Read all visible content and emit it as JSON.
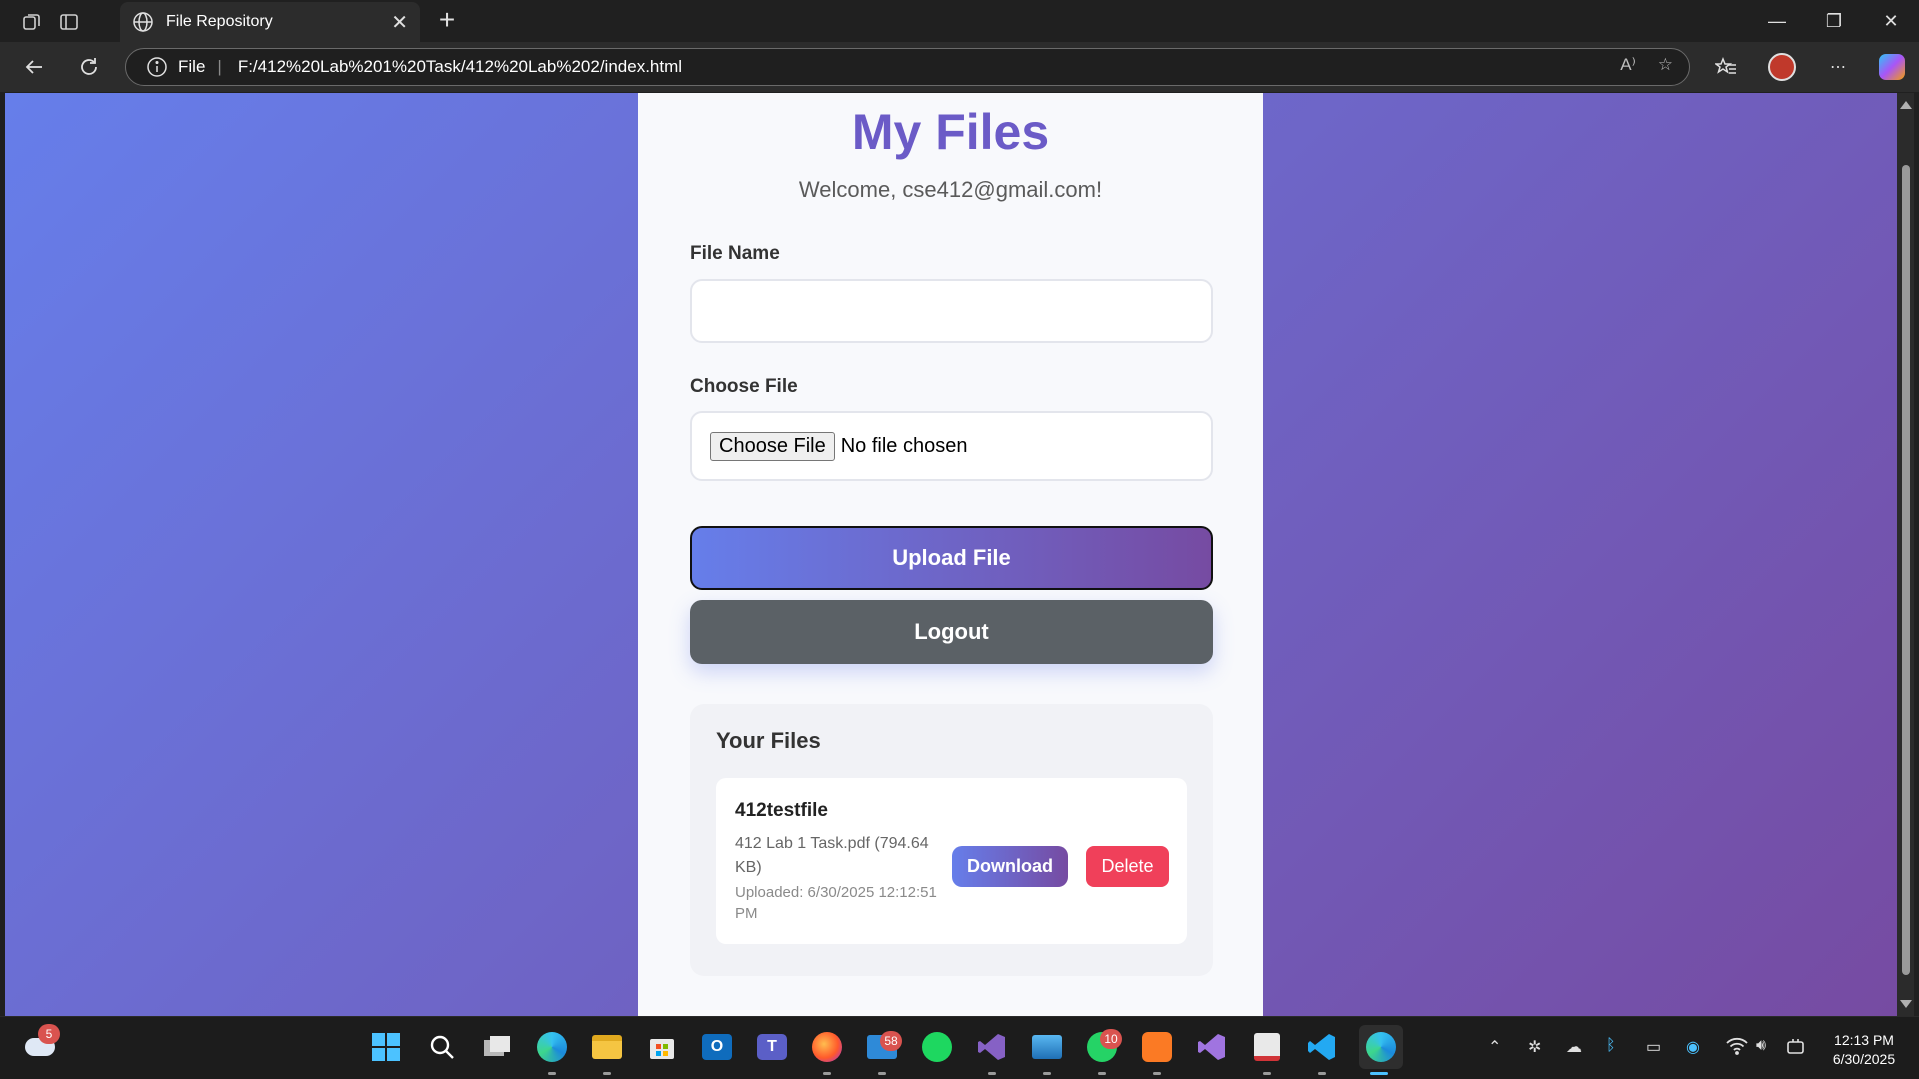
{
  "browser": {
    "tab_title": "File Repository",
    "url_protocol": "File",
    "url_separator": "|",
    "url": "F:/412%20Lab%201%20Task/412%20Lab%202/index.html"
  },
  "page": {
    "title": "My Files",
    "welcome": "Welcome, cse412@gmail.com!",
    "file_name_label": "File Name",
    "file_name_value": "",
    "choose_file_label": "Choose File",
    "choose_file_button": "Choose File",
    "no_file_text": "No file chosen",
    "upload_button": "Upload File",
    "logout_button": "Logout",
    "files_heading": "Your Files",
    "files": [
      {
        "name": "412testfile",
        "meta": "412 Lab 1 Task.pdf (794.64 KB)",
        "uploaded": "Uploaded: 6/30/2025 12:12:51 PM",
        "download_label": "Download",
        "delete_label": "Delete"
      }
    ]
  },
  "taskbar": {
    "weather_badge": "5",
    "mail_badge": "58",
    "whatsapp_badge": "10",
    "time": "12:13 PM",
    "date": "6/30/2025"
  },
  "colors": {
    "gradient_start": "#667eea",
    "gradient_end": "#764ba2",
    "title": "#6b5bc7",
    "delete": "#f0405a",
    "logout": "#5b6166"
  }
}
